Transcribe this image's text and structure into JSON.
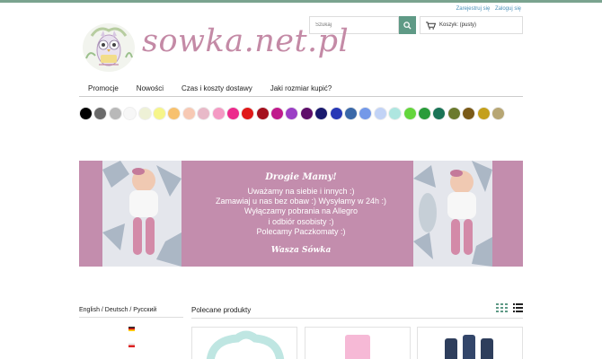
{
  "header": {
    "auth_links": [
      "Zarejestruj się",
      "Zaloguj się"
    ],
    "search_placeholder": "Szukaj",
    "cart_label": "Koszyk: (pusty)",
    "logo_text": "sowka.net.pl"
  },
  "nav": [
    "Promocje",
    "Nowości",
    "Czas i koszty dostawy",
    "Jaki rozmiar kupić?"
  ],
  "color_swatches": [
    "#000000",
    "#6b6b6b",
    "#b9b9b9",
    "#f7f7f7",
    "#eef1d6",
    "#f6f58a",
    "#f7c16e",
    "#f7c9b4",
    "#e8b9c8",
    "#f49ac4",
    "#ec2a8c",
    "#e01818",
    "#a5101e",
    "#c01a8c",
    "#9b3fc5",
    "#5e0e6a",
    "#1a1a6e",
    "#2838b6",
    "#3a68a8",
    "#7499e8",
    "#c2d3f6",
    "#aee6e0",
    "#64d63c",
    "#2a9c3a",
    "#1a7456",
    "#6b7a2e",
    "#7a5a18",
    "#c4a01c",
    "#b7a674"
  ],
  "banner": {
    "headline": "Drogie Mamy!",
    "lines": [
      "Uważamy na siebie i innych :)",
      "Zamawiaj u nas bez obaw :) Wysyłamy w 24h :)",
      "Wyłączamy pobrania na Allegro",
      "i odbiór osobisty :)",
      "Polecamy Paczkomaty :)"
    ],
    "signature": "Wasza Sówka",
    "bg_color": "#c38dad"
  },
  "languages": {
    "label": "English / Deutsch / Русский",
    "flags": [
      "german-flag",
      "polish-flag",
      "us-flag"
    ]
  },
  "products": {
    "title": "Polecane produkty",
    "view_icons": [
      "grid-view-icon",
      "list-view-icon"
    ]
  },
  "accent_color": "#5f9a86"
}
